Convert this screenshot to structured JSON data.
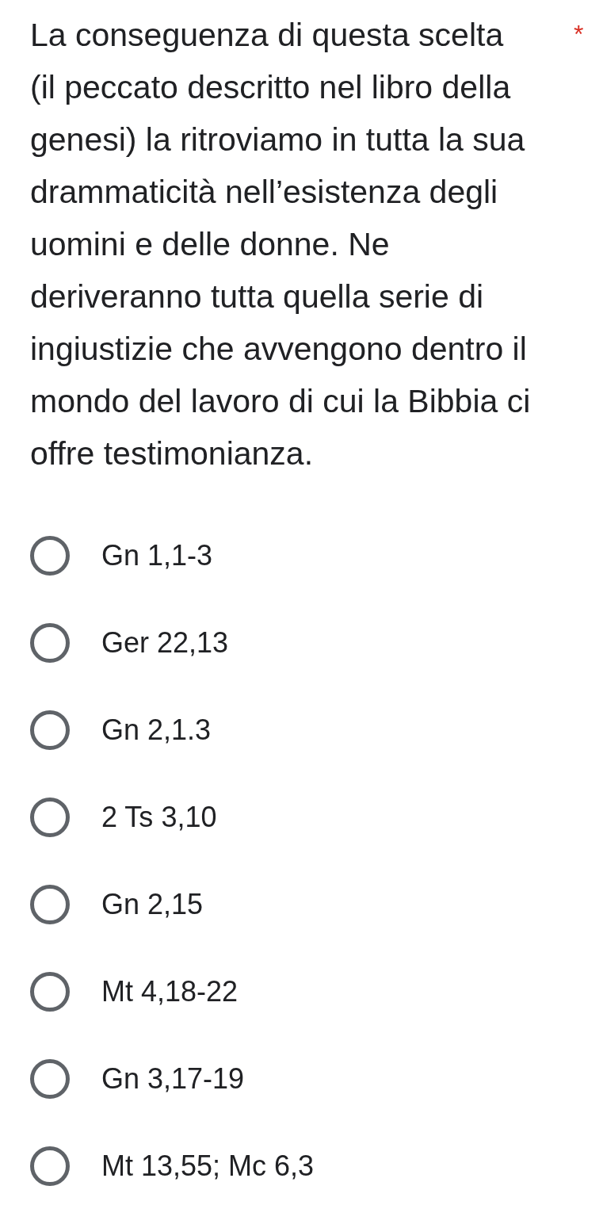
{
  "question": {
    "text": "La conseguenza di questa scelta (il peccato descritto nel libro della genesi) la ritroviamo in tutta la sua drammaticità nell’esistenza degli uomini e delle donne. Ne deriveranno tutta quella serie di ingiustizie che avvengono dentro il mondo del lavoro di cui la Bibbia ci offre testimonianza.",
    "required": true,
    "required_mark": "*"
  },
  "options": [
    {
      "label": "Gn 1,1-3",
      "selected": false
    },
    {
      "label": "Ger 22,13",
      "selected": false
    },
    {
      "label": "Gn 2,1.3",
      "selected": false
    },
    {
      "label": "2 Ts 3,10",
      "selected": false
    },
    {
      "label": "Gn 2,15",
      "selected": false
    },
    {
      "label": "Mt 4,18-22",
      "selected": false
    },
    {
      "label": "Gn 3,17-19",
      "selected": false
    },
    {
      "label": "Mt 13,55; Mc 6,3",
      "selected": false
    }
  ]
}
